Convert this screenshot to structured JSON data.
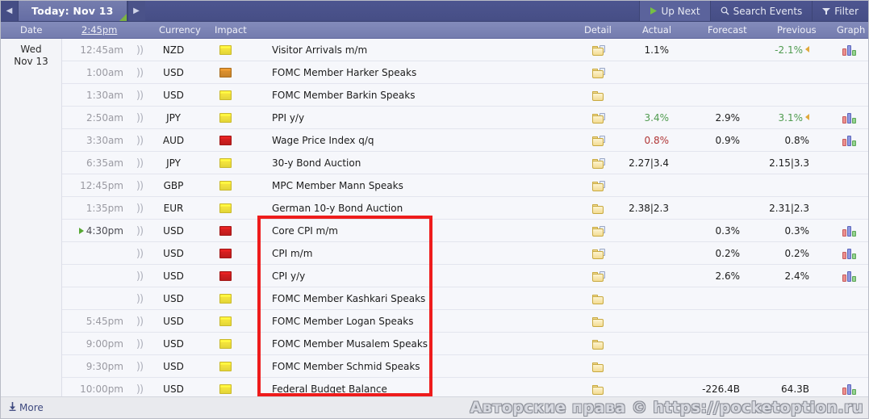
{
  "topbar": {
    "prev_label": "◀",
    "next_label": "▶",
    "tab_label": "Today: Nov 13",
    "up_next_label": "Up Next",
    "search_label": "Search Events",
    "filter_label": "Filter",
    "up_next_icon": "play-icon",
    "search_icon": "magnifier-icon",
    "filter_icon": "funnel-icon",
    "accent_green": "#7cb342",
    "bar_color": "#4a5289",
    "tab_color": "#6a72a8"
  },
  "columns": {
    "date": "Date",
    "time": "2:45pm",
    "currency": "Currency",
    "impact": "Impact",
    "detail": "Detail",
    "actual": "Actual",
    "forecast": "Forecast",
    "previous": "Previous",
    "graph": "Graph"
  },
  "date_group": {
    "weekday": "Wed",
    "date": "Nov 13"
  },
  "rows": [
    {
      "time": "12:45am",
      "has_play": false,
      "sound": true,
      "currency": "NZD",
      "impact": "yellow",
      "title": "Visitor Arrivals m/m",
      "detail": "page",
      "actual": "1.1%",
      "actual_color": "black",
      "forecast": "",
      "previous": "-2.1%",
      "previous_color": "green",
      "prev_arrow": true,
      "graph": true
    },
    {
      "time": "1:00am",
      "has_play": false,
      "sound": true,
      "currency": "USD",
      "impact": "orange",
      "title": "FOMC Member Harker Speaks",
      "detail": "page",
      "actual": "",
      "actual_color": "black",
      "forecast": "",
      "previous": "",
      "previous_color": "black",
      "prev_arrow": false,
      "graph": false
    },
    {
      "time": "1:30am",
      "has_play": false,
      "sound": true,
      "currency": "USD",
      "impact": "yellow",
      "title": "FOMC Member Barkin Speaks",
      "detail": "plain",
      "actual": "",
      "actual_color": "black",
      "forecast": "",
      "previous": "",
      "previous_color": "black",
      "prev_arrow": false,
      "graph": false
    },
    {
      "time": "2:50am",
      "has_play": false,
      "sound": true,
      "currency": "JPY",
      "impact": "yellow",
      "title": "PPI y/y",
      "detail": "page",
      "actual": "3.4%",
      "actual_color": "green",
      "forecast": "2.9%",
      "previous": "3.1%",
      "previous_color": "green",
      "prev_arrow": true,
      "graph": true
    },
    {
      "time": "3:30am",
      "has_play": false,
      "sound": true,
      "currency": "AUD",
      "impact": "red",
      "title": "Wage Price Index q/q",
      "detail": "page",
      "actual": "0.8%",
      "actual_color": "red",
      "forecast": "0.9%",
      "previous": "0.8%",
      "previous_color": "black",
      "prev_arrow": false,
      "graph": true
    },
    {
      "time": "6:35am",
      "has_play": false,
      "sound": true,
      "currency": "JPY",
      "impact": "yellow",
      "title": "30-y Bond Auction",
      "detail": "page",
      "actual": "2.27|3.4",
      "actual_color": "black",
      "forecast": "",
      "previous": "2.15|3.3",
      "previous_color": "black",
      "prev_arrow": false,
      "graph": false
    },
    {
      "time": "12:45pm",
      "has_play": false,
      "sound": true,
      "currency": "GBP",
      "impact": "yellow",
      "title": "MPC Member Mann Speaks",
      "detail": "page",
      "actual": "",
      "actual_color": "black",
      "forecast": "",
      "previous": "",
      "previous_color": "black",
      "prev_arrow": false,
      "graph": false
    },
    {
      "time": "1:35pm",
      "has_play": false,
      "sound": true,
      "currency": "EUR",
      "impact": "yellow",
      "title": "German 10-y Bond Auction",
      "detail": "plain",
      "actual": "2.38|2.3",
      "actual_color": "black",
      "forecast": "",
      "previous": "2.31|2.3",
      "previous_color": "black",
      "prev_arrow": false,
      "graph": false
    },
    {
      "time": "4:30pm",
      "has_play": true,
      "sound": true,
      "currency": "USD",
      "impact": "red",
      "title": "Core CPI m/m",
      "detail": "page",
      "actual": "",
      "actual_color": "black",
      "forecast": "0.3%",
      "previous": "0.3%",
      "previous_color": "black",
      "prev_arrow": false,
      "graph": true
    },
    {
      "time": "",
      "has_play": false,
      "sound": true,
      "currency": "USD",
      "impact": "red",
      "title": "CPI m/m",
      "detail": "page",
      "actual": "",
      "actual_color": "black",
      "forecast": "0.2%",
      "previous": "0.2%",
      "previous_color": "black",
      "prev_arrow": false,
      "graph": true
    },
    {
      "time": "",
      "has_play": false,
      "sound": true,
      "currency": "USD",
      "impact": "red",
      "title": "CPI y/y",
      "detail": "page",
      "actual": "",
      "actual_color": "black",
      "forecast": "2.6%",
      "previous": "2.4%",
      "previous_color": "black",
      "prev_arrow": false,
      "graph": true
    },
    {
      "time": "",
      "has_play": false,
      "sound": true,
      "currency": "USD",
      "impact": "yellow",
      "title": "FOMC Member Kashkari Speaks",
      "detail": "plain",
      "actual": "",
      "actual_color": "black",
      "forecast": "",
      "previous": "",
      "previous_color": "black",
      "prev_arrow": false,
      "graph": false
    },
    {
      "time": "5:45pm",
      "has_play": false,
      "sound": true,
      "currency": "USD",
      "impact": "yellow",
      "title": "FOMC Member Logan Speaks",
      "detail": "plain",
      "actual": "",
      "actual_color": "black",
      "forecast": "",
      "previous": "",
      "previous_color": "black",
      "prev_arrow": false,
      "graph": false
    },
    {
      "time": "9:00pm",
      "has_play": false,
      "sound": true,
      "currency": "USD",
      "impact": "yellow",
      "title": "FOMC Member Musalem Speaks",
      "detail": "plain",
      "actual": "",
      "actual_color": "black",
      "forecast": "",
      "previous": "",
      "previous_color": "black",
      "prev_arrow": false,
      "graph": false
    },
    {
      "time": "9:30pm",
      "has_play": false,
      "sound": true,
      "currency": "USD",
      "impact": "yellow",
      "title": "FOMC Member Schmid Speaks",
      "detail": "plain",
      "actual": "",
      "actual_color": "black",
      "forecast": "",
      "previous": "",
      "previous_color": "black",
      "prev_arrow": false,
      "graph": false
    },
    {
      "time": "10:00pm",
      "has_play": false,
      "sound": true,
      "currency": "USD",
      "impact": "yellow",
      "title": "Federal Budget Balance",
      "detail": "plain",
      "actual": "",
      "actual_color": "black",
      "forecast": "-226.4B",
      "previous": "64.3B",
      "previous_color": "black",
      "prev_arrow": false,
      "graph": true
    }
  ],
  "footer": {
    "more_label": "More",
    "more_icon": "download-arrow-icon"
  },
  "watermark": {
    "text": "Авторские права © https://pocketoption.ru"
  },
  "annotation": {
    "color": "#ee1c1c"
  }
}
